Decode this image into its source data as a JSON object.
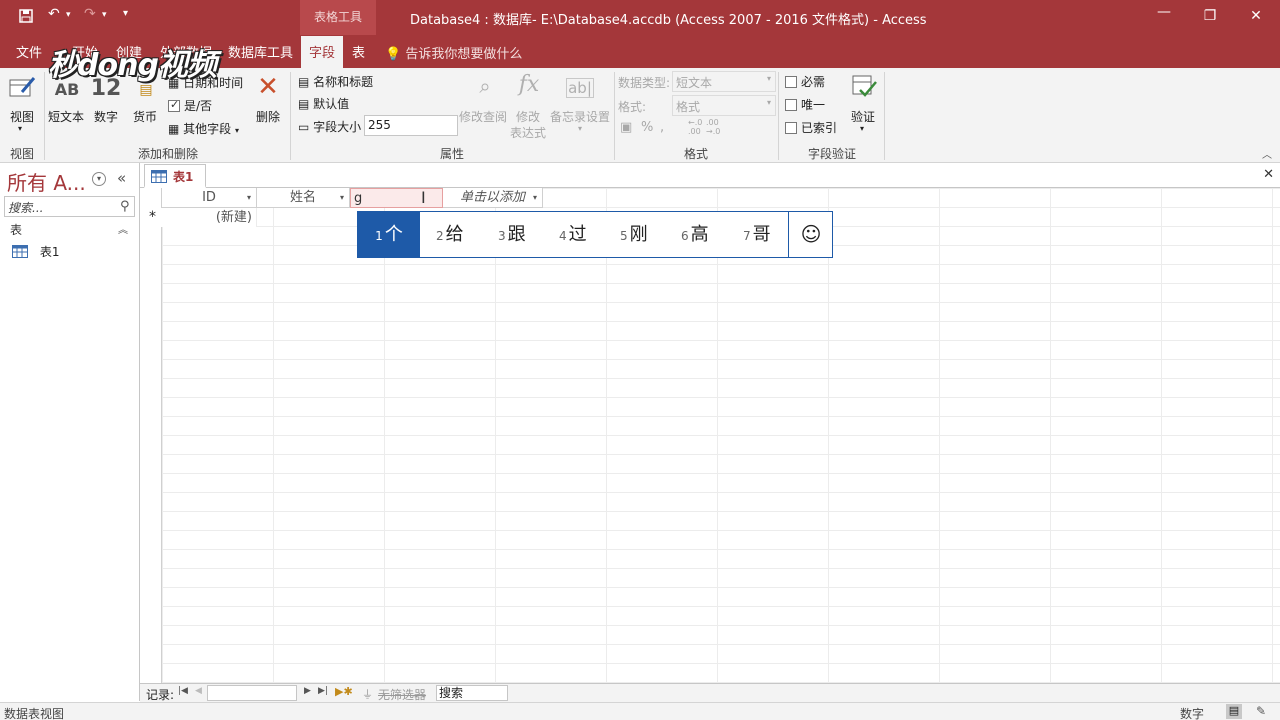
{
  "colors": {
    "accent": "#a4373a",
    "ime_highlight": "#1e5aa8"
  },
  "titlebar": {
    "contextual_group": "表格工具",
    "title": "Database4 : 数据库- E:\\Database4.accdb (Access 2007 - 2016 文件格式)  -  Access",
    "save_icon": "save-icon",
    "undo_icon": "undo-icon",
    "redo_icon": "redo-icon"
  },
  "tabs": {
    "file": "文件",
    "home": "开始",
    "create": "创建",
    "external": "外部数据",
    "dbtools": "数据库工具",
    "fields": "字段",
    "table": "表",
    "tellme": "告诉我你想要做什么"
  },
  "watermark": "秒dong视频",
  "ribbon": {
    "view": {
      "label": "视图",
      "group": "视图"
    },
    "add_delete": {
      "short_text": "短文本",
      "number": "数字",
      "currency": "货币",
      "datetime": "日期和时间",
      "yesno": "是/否",
      "more_fields": "其他字段",
      "delete": "删除",
      "group": "添加和删除"
    },
    "properties": {
      "name_caption": "名称和标题",
      "default_value": "默认值",
      "field_size_label": "字段大小",
      "field_size_value": "255",
      "modify_lookups": "修改查阅",
      "modify_expr_1": "修改",
      "modify_expr_2": "表达式",
      "memo_settings": "备忘录设置",
      "group": "属性"
    },
    "formatting": {
      "data_type_label": "数据类型:",
      "data_type_value": "短文本",
      "format_label": "格式:",
      "format_value": "格式",
      "group": "格式"
    },
    "validation": {
      "required": "必需",
      "unique": "唯一",
      "indexed": "已索引",
      "validate": "验证",
      "group": "字段验证"
    }
  },
  "nav": {
    "title": "所有 A...",
    "search_placeholder": "搜索...",
    "section": "表",
    "items": [
      "表1"
    ]
  },
  "doc": {
    "tab_label": "表1",
    "columns": [
      "ID",
      "姓名",
      "g",
      "单击以添加"
    ],
    "new_row_marker": "*",
    "new_row_id": "(新建)"
  },
  "ime": {
    "candidates": [
      {
        "n": "1",
        "t": "个"
      },
      {
        "n": "2",
        "t": "给"
      },
      {
        "n": "3",
        "t": "跟"
      },
      {
        "n": "4",
        "t": "过"
      },
      {
        "n": "5",
        "t": "刚"
      },
      {
        "n": "6",
        "t": "高"
      },
      {
        "n": "7",
        "t": "哥"
      }
    ],
    "emoji": "☺"
  },
  "recnav": {
    "label": "记录:",
    "filter": "无筛选器",
    "search": "搜索"
  },
  "status": {
    "left": "数据表视图",
    "right": "数字"
  }
}
